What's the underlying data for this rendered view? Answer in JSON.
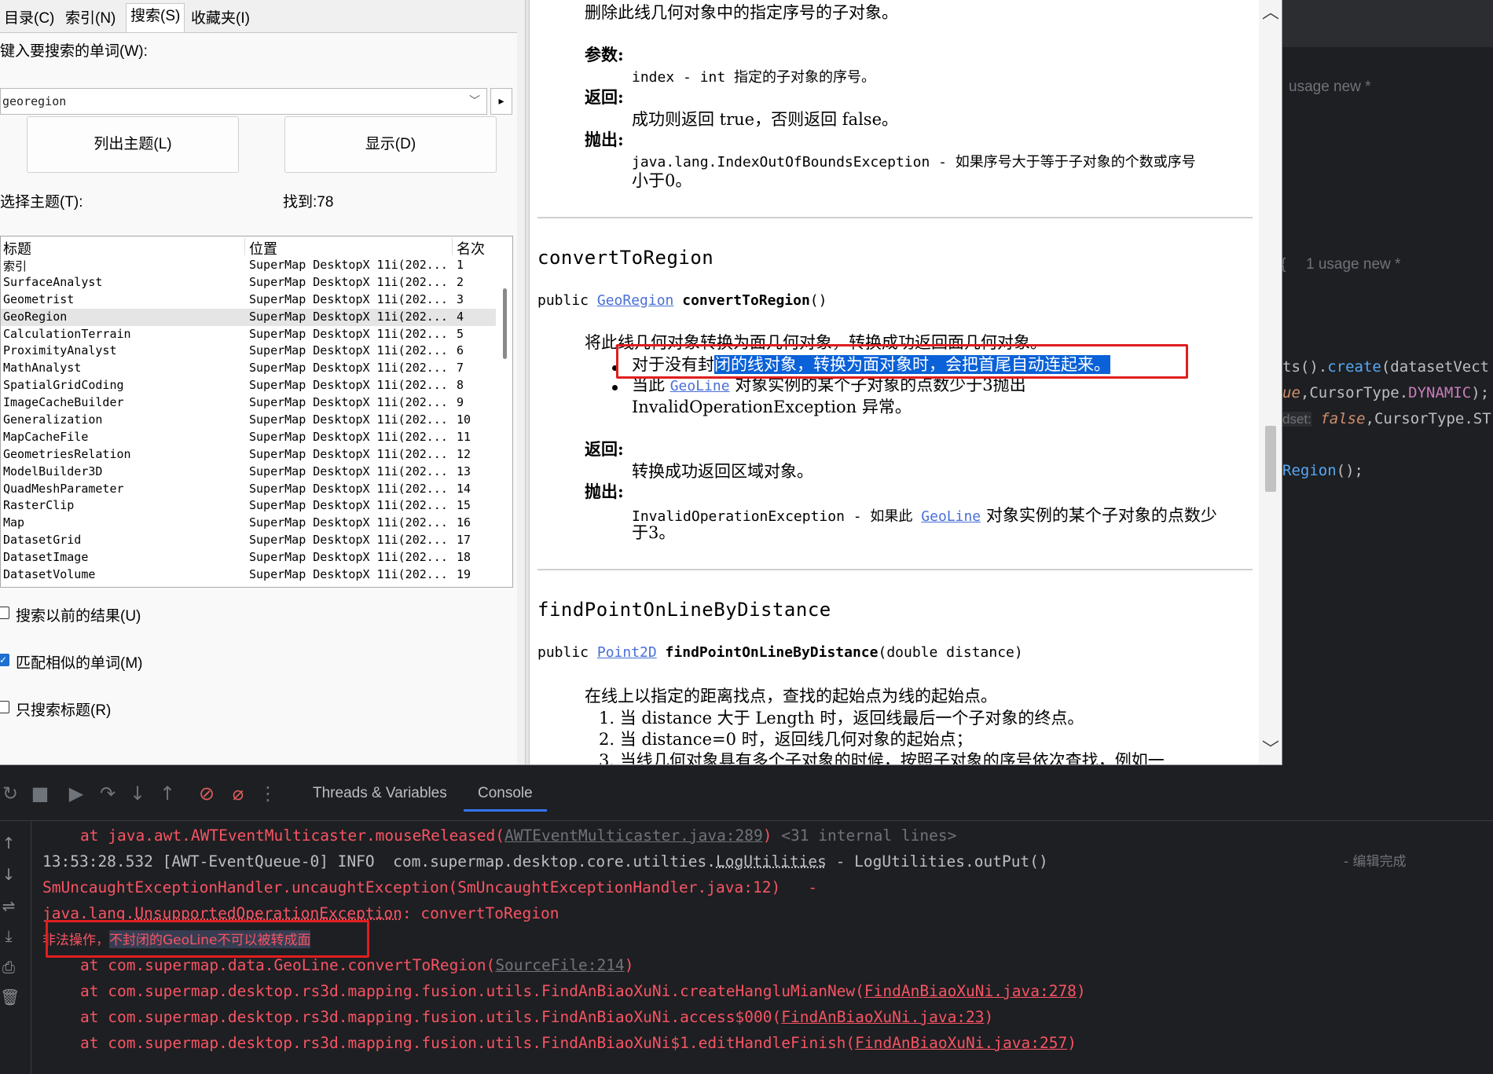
{
  "help_tabs": [
    "目录(C)",
    "索引(N)",
    "搜索(S)",
    "收藏夹(I)"
  ],
  "search": {
    "label": "键入要搜索的单词(W):",
    "value": "georegion",
    "go_glyph": "▸",
    "list_topics_label": "列出主题(L)",
    "display_label": "显示(D)",
    "select_label": "选择主题(T):",
    "found_label": "找到:78"
  },
  "topic_table": {
    "headers": [
      "标题",
      "位置",
      "名次"
    ],
    "rows": [
      {
        "title": "索引",
        "location": "SuperMap DesktopX 11i(202...",
        "rank": "1"
      },
      {
        "title": "SurfaceAnalyst",
        "location": "SuperMap DesktopX 11i(202...",
        "rank": "2"
      },
      {
        "title": "Geometrist",
        "location": "SuperMap DesktopX 11i(202...",
        "rank": "3"
      },
      {
        "title": "GeoRegion",
        "location": "SuperMap DesktopX 11i(202...",
        "rank": "4"
      },
      {
        "title": "CalculationTerrain",
        "location": "SuperMap DesktopX 11i(202...",
        "rank": "5"
      },
      {
        "title": "ProximityAnalyst",
        "location": "SuperMap DesktopX 11i(202...",
        "rank": "6"
      },
      {
        "title": "MathAnalyst",
        "location": "SuperMap DesktopX 11i(202...",
        "rank": "7"
      },
      {
        "title": "SpatialGridCoding",
        "location": "SuperMap DesktopX 11i(202...",
        "rank": "8"
      },
      {
        "title": "ImageCacheBuilder",
        "location": "SuperMap DesktopX 11i(202...",
        "rank": "9"
      },
      {
        "title": "Generalization",
        "location": "SuperMap DesktopX 11i(202...",
        "rank": "10"
      },
      {
        "title": "MapCacheFile",
        "location": "SuperMap DesktopX 11i(202...",
        "rank": "11"
      },
      {
        "title": "GeometriesRelation",
        "location": "SuperMap DesktopX 11i(202...",
        "rank": "12"
      },
      {
        "title": "ModelBuilder3D",
        "location": "SuperMap DesktopX 11i(202...",
        "rank": "13"
      },
      {
        "title": "QuadMeshParameter",
        "location": "SuperMap DesktopX 11i(202...",
        "rank": "14"
      },
      {
        "title": "RasterClip",
        "location": "SuperMap DesktopX 11i(202...",
        "rank": "15"
      },
      {
        "title": "Map",
        "location": "SuperMap DesktopX 11i(202...",
        "rank": "16"
      },
      {
        "title": "DatasetGrid",
        "location": "SuperMap DesktopX 11i(202...",
        "rank": "17"
      },
      {
        "title": "DatasetImage",
        "location": "SuperMap DesktopX 11i(202...",
        "rank": "18"
      },
      {
        "title": "DatasetVolume",
        "location": "SuperMap DesktopX 11i(202...",
        "rank": "19"
      }
    ]
  },
  "options": {
    "search_previous": "搜索以前的结果(U)",
    "match_similar": "匹配相似的单词(M)",
    "title_only": "只搜索标题(R)"
  },
  "doc": {
    "top_desc": "删除此线几何对象中的指定序号的子对象。",
    "params_heading": "参数:",
    "param_line": "index - int 指定的子对象的序号。",
    "returns_heading": "返回:",
    "returns_line": "成功则返回 true，否则返回 false。",
    "throws_heading": "抛出:",
    "throws_line1": "java.lang.IndexOutOfBoundsException - 如果序号大于等于子对象的个数或序号",
    "throws_line2": "小于0。",
    "m1_name": "convertToRegion",
    "m1_sig_prefix": "public ",
    "m1_sig_type": "GeoRegion",
    "m1_sig_name": " convertToRegion",
    "m1_sig_suffix": "()",
    "m1_desc": "将此线几何对象转换为面几何对象，转换成功返回面几何对象。",
    "m1_b1_pre": "对于没有封",
    "m1_b1_hl": "闭的线对象，转换为面对象时，会把首尾自动连起来。",
    "m1_b2_pre": "当此 ",
    "m1_b2_link": "GeoLine",
    "m1_b2_post": " 对象实例的某个子对象的点数少于3抛出",
    "m1_b2_line2": "InvalidOperationException 异常。",
    "m1_returns_heading": "返回:",
    "m1_returns_line": "转换成功返回区域对象。",
    "m1_throws_heading": "抛出:",
    "m1_throws_pre": "InvalidOperationException - 如果此 ",
    "m1_throws_link": "GeoLine",
    "m1_throws_post": " 对象实例的某个子对象的点数少",
    "m1_throws_line2": "于3。",
    "m2_name": "findPointOnLineByDistance",
    "m2_sig_prefix": "public ",
    "m2_sig_type": "Point2D",
    "m2_sig_name": " findPointOnLineByDistance",
    "m2_sig_suffix": "(double distance)",
    "m2_desc": "在线上以指定的距离找点，查找的起始点为线的起始点。",
    "m2_items": [
      "1.  当 distance 大于 Length 时，返回线最后一个子对象的终点。",
      "2.  当 distance=0 时，返回线几何对象的起始点；",
      "3.  当线几何对象具有多个子对象的时候，按照子对象的序号依次查找，例如一"
    ]
  },
  "ide": {
    "hint1": "usage   new *",
    "hint2": "1 usage   new *",
    "brace": "{",
    "code1_a": "ts().",
    "code1_b": "create",
    "code1_c": "(datasetVect",
    "code2_a": "ue",
    "code2_b": ",CursorType.",
    "code2_c": "DYNAMIC",
    "code2_d": ");",
    "code3_hint": "dset:",
    "code3_a": "false",
    "code3_b": ",CursorType.ST",
    "code4_a": "Region",
    "code4_b": "();",
    "tab_threads": "Threads & Variables",
    "tab_console": "Console"
  },
  "console": {
    "l1_pre": "at java.awt.AWTEventMulticaster.mouseReleased(",
    "l1_link": "AWTEventMulticaster.java:289",
    "l1_post": ") ",
    "l1_internal": "<31 internal lines>",
    "l2_a": "13:53:28.532 [AWT-EventQueue-0] INFO  com.supermap.desktop.core.utilties.",
    "l2_b": "LogUtilities",
    "l2_c": " - LogUtilities.outPut()",
    "l2_right": "- 编辑完成",
    "l3": "SmUncaughtExceptionHandler.uncaughtException(SmUncaughtExceptionHandler.java:12)   -",
    "l4_a": "java.lang.",
    "l4_b": "UnsupportedOperationException",
    "l4_c": ": convertToRegion",
    "l5_a": "非法操作，",
    "l5_b": "不封闭的GeoLine不可以被转成面",
    "l6_pre": "at com.supermap.data.GeoLine.convertToRegion(",
    "l6_link": "SourceFile:214",
    "l6_post": ")",
    "l7_pre": "at com.supermap.desktop.rs3d.mapping.fusion.utils.FindAnBiaoXuNi.createHangluMianNew(",
    "l7_link": "FindAnBiaoXuNi.java:278",
    "l7_post": ")",
    "l8_pre": "at com.supermap.desktop.rs3d.mapping.fusion.utils.FindAnBiaoXuNi.access$000(",
    "l8_link": "FindAnBiaoXuNi.java:23",
    "l8_post": ")",
    "l9_pre": "at com.supermap.desktop.rs3d.mapping.fusion.utils.FindAnBiaoXuNi$1.editHandleFinish(",
    "l9_link": "FindAnBiaoXuNi.java:257",
    "l9_post": ")"
  }
}
